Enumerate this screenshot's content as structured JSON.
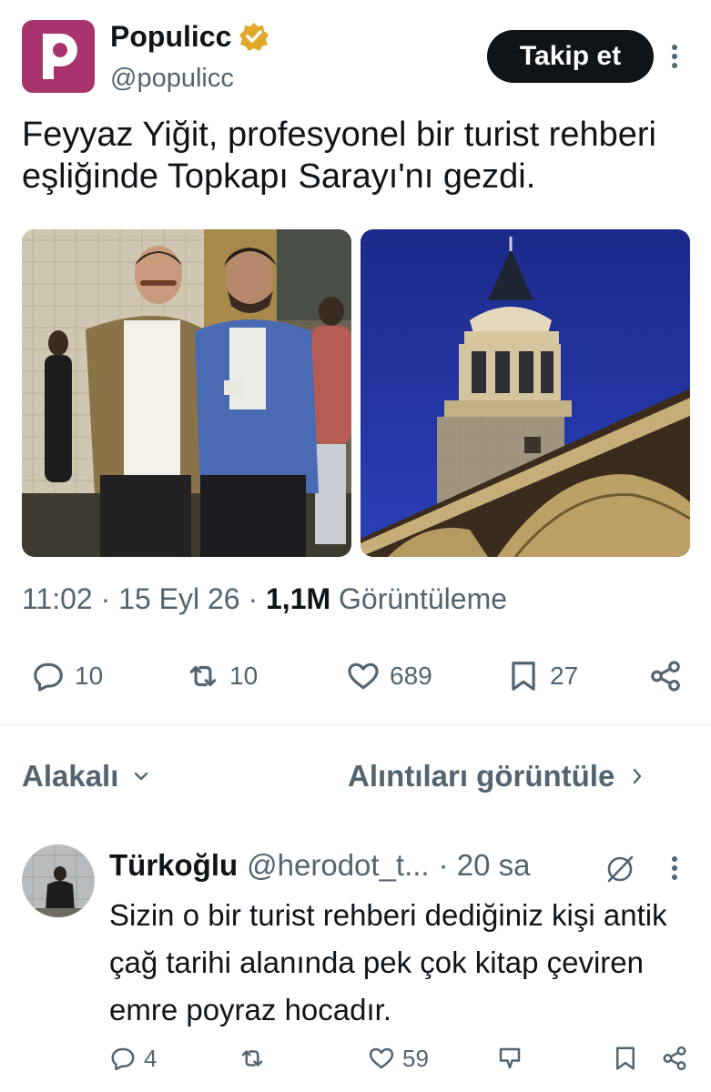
{
  "account": {
    "name": "Populicc",
    "handle": "@populicc",
    "verified": true,
    "avatar_color": "#a8336f"
  },
  "follow_label": "Takip et",
  "tweet": {
    "text": "Feyyaz Yiğit, profesyonel bir turist rehberi eşliğinde Topkapı Sarayı'nı gezdi.",
    "time": "11:02 · 15 Eyl 26 · ",
    "views_count": "1,1M",
    "views_label": " Görüntüleme",
    "images": [
      "photo-two-men-palace-courtyard",
      "photo-palace-tower-night"
    ]
  },
  "actions": {
    "replies": "10",
    "retweets": "10",
    "likes": "689",
    "bookmarks": "27"
  },
  "sort": {
    "label": "Alakalı",
    "quotes_link": "Alıntıları görüntüle"
  },
  "reply": {
    "name": "Türkoğlu",
    "handle": "@herodot_t...",
    "time": "· 20 sa",
    "text": "Sizin o bir turist rehberi dediğiniz kişi antik çağ tarihi alanında pek çok kitap çeviren emre poyraz hocadır.",
    "replies": "4",
    "retweets": "",
    "likes": "59"
  },
  "colors": {
    "text": "#0f1419",
    "secondary": "#536471",
    "verified_badge": "#e0a92b"
  }
}
